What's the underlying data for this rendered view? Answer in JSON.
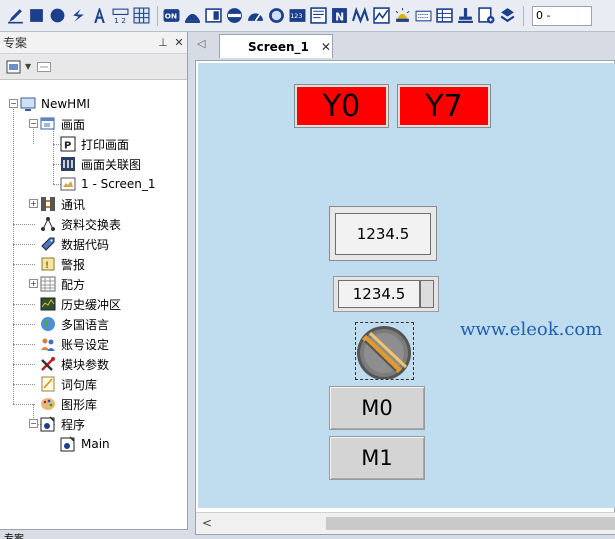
{
  "toolbar": {
    "icons": [
      "pen-icon",
      "rectangle-icon",
      "circle-icon",
      "lightning-icon",
      "text-icon",
      "numeric-display-icon",
      "grid-icon",
      "on-button-icon",
      "word-lamp-icon",
      "bit-lamp-icon",
      "scale-icon",
      "half-gauge-icon",
      "circle-gauge-icon",
      "number-123-icon",
      "text-box-icon",
      "n-icon",
      "wave-icon",
      "trend-icon",
      "lamp-icon",
      "keyboard-icon",
      "table-icon",
      "stamp-icon",
      "add-object-icon",
      "layers-icon"
    ],
    "on_label": "ON",
    "num_label": "123",
    "n_label": "N",
    "select_value": "0 -"
  },
  "panel": {
    "title": "专案",
    "pin": "ᚬ",
    "close": "✕",
    "bottom_tab": "专案",
    "tree": [
      {
        "label": "NewHMI",
        "icon": "monitor-icon"
      },
      {
        "label": "画面",
        "icon": "screens-icon"
      },
      {
        "label": "打印画面",
        "icon": "print-icon"
      },
      {
        "label": "画面关联图",
        "icon": "relation-icon"
      },
      {
        "label": "1 - Screen_1",
        "icon": "screen-page-icon"
      },
      {
        "label": "通讯",
        "icon": "comm-icon"
      },
      {
        "label": "资料交换表",
        "icon": "exchange-icon"
      },
      {
        "label": "数据代码",
        "icon": "tag-icon"
      },
      {
        "label": "警报",
        "icon": "alarm-icon"
      },
      {
        "label": "配方",
        "icon": "recipe-icon"
      },
      {
        "label": "历史缓冲区",
        "icon": "history-icon"
      },
      {
        "label": "多国语言",
        "icon": "globe-icon"
      },
      {
        "label": "账号设定",
        "icon": "users-icon"
      },
      {
        "label": "模块参数",
        "icon": "tools-icon"
      },
      {
        "label": "词句库",
        "icon": "phrase-icon"
      },
      {
        "label": "图形库",
        "icon": "palette-icon"
      },
      {
        "label": "程序",
        "icon": "program-icon"
      },
      {
        "label": "Main",
        "icon": "program-main-icon"
      }
    ]
  },
  "editor": {
    "tab_label": "Screen_1",
    "tab_close": "✕",
    "lamps": [
      "Y0",
      "Y7"
    ],
    "lamp_color": "#ff0000",
    "numeric_display": "1234.5",
    "numeric_input": "1234.5",
    "buttons": [
      "M0",
      "M1"
    ],
    "watermark": "www.eleok.com",
    "canvas_color": "#c0dcef"
  }
}
